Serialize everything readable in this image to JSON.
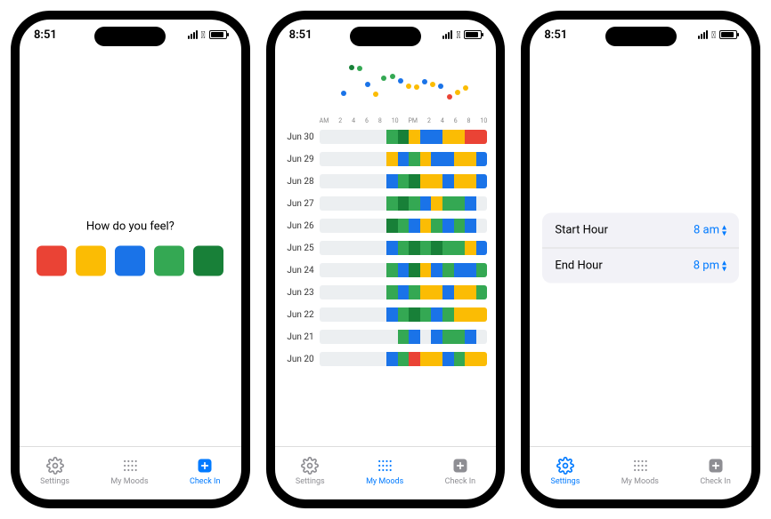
{
  "status": {
    "time": "8:51"
  },
  "tabbar": {
    "settings": "Settings",
    "mymoods": "My Moods",
    "checkin": "Check In"
  },
  "checkin": {
    "prompt": "How do you feel?",
    "moods": [
      {
        "name": "red",
        "color": "#ea4335"
      },
      {
        "name": "orange",
        "color": "#fbbc04"
      },
      {
        "name": "blue",
        "color": "#1a73e8"
      },
      {
        "name": "green",
        "color": "#34a853"
      },
      {
        "name": "dgreen",
        "color": "#188038"
      }
    ]
  },
  "settings": {
    "rows": [
      {
        "label": "Start Hour",
        "value": "8 am"
      },
      {
        "label": "End Hour",
        "value": "8 pm"
      }
    ]
  },
  "moods": {
    "hour_labels": [
      "AM",
      "2",
      "4",
      "6",
      "8",
      "10",
      "PM",
      "2",
      "4",
      "6",
      "8",
      "10"
    ],
    "scatter": [
      {
        "x": 28,
        "y": 60,
        "c": "blue"
      },
      {
        "x": 32,
        "y": 18,
        "c": "dgreen"
      },
      {
        "x": 36,
        "y": 20,
        "c": "green"
      },
      {
        "x": 40,
        "y": 45,
        "c": "blue"
      },
      {
        "x": 44,
        "y": 62,
        "c": "orange"
      },
      {
        "x": 48,
        "y": 35,
        "c": "green"
      },
      {
        "x": 52,
        "y": 33,
        "c": "green"
      },
      {
        "x": 56,
        "y": 40,
        "c": "blue"
      },
      {
        "x": 60,
        "y": 48,
        "c": "orange"
      },
      {
        "x": 64,
        "y": 50,
        "c": "orange"
      },
      {
        "x": 68,
        "y": 42,
        "c": "blue"
      },
      {
        "x": 72,
        "y": 46,
        "c": "orange"
      },
      {
        "x": 76,
        "y": 48,
        "c": "blue"
      },
      {
        "x": 80,
        "y": 65,
        "c": "red"
      },
      {
        "x": 84,
        "y": 58,
        "c": "orange"
      },
      {
        "x": 88,
        "y": 52,
        "c": "orange"
      }
    ],
    "days": [
      {
        "label": "Jun 30",
        "segs": [
          "empty",
          "empty",
          "empty",
          "empty",
          "empty",
          "empty",
          "green",
          "dgreen",
          "orange",
          "blue",
          "blue",
          "orange",
          "orange",
          "red",
          "red"
        ]
      },
      {
        "label": "Jun 29",
        "segs": [
          "empty",
          "empty",
          "empty",
          "empty",
          "empty",
          "empty",
          "orange",
          "blue",
          "green",
          "orange",
          "blue",
          "blue",
          "orange",
          "orange",
          "blue"
        ]
      },
      {
        "label": "Jun 28",
        "segs": [
          "empty",
          "empty",
          "empty",
          "empty",
          "empty",
          "empty",
          "blue",
          "green",
          "dgreen",
          "orange",
          "orange",
          "blue",
          "orange",
          "orange",
          "blue"
        ]
      },
      {
        "label": "Jun 27",
        "segs": [
          "empty",
          "empty",
          "empty",
          "empty",
          "empty",
          "empty",
          "green",
          "dgreen",
          "green",
          "blue",
          "orange",
          "green",
          "green",
          "blue",
          "empty"
        ]
      },
      {
        "label": "Jun 26",
        "segs": [
          "empty",
          "empty",
          "empty",
          "empty",
          "empty",
          "empty",
          "dgreen",
          "green",
          "blue",
          "orange",
          "green",
          "blue",
          "green",
          "blue",
          "empty"
        ]
      },
      {
        "label": "Jun 25",
        "segs": [
          "empty",
          "empty",
          "empty",
          "empty",
          "empty",
          "empty",
          "blue",
          "green",
          "dgreen",
          "green",
          "dgreen",
          "green",
          "green",
          "orange",
          "blue"
        ]
      },
      {
        "label": "Jun 24",
        "segs": [
          "empty",
          "empty",
          "empty",
          "empty",
          "empty",
          "empty",
          "green",
          "blue",
          "dgreen",
          "orange",
          "blue",
          "green",
          "blue",
          "blue",
          "green"
        ]
      },
      {
        "label": "Jun 23",
        "segs": [
          "empty",
          "empty",
          "empty",
          "empty",
          "empty",
          "empty",
          "green",
          "blue",
          "green",
          "orange",
          "orange",
          "blue",
          "orange",
          "orange",
          "green"
        ]
      },
      {
        "label": "Jun 22",
        "segs": [
          "empty",
          "empty",
          "empty",
          "empty",
          "empty",
          "empty",
          "blue",
          "green",
          "dgreen",
          "green",
          "blue",
          "green",
          "orange",
          "orange",
          "orange"
        ]
      },
      {
        "label": "Jun 21",
        "segs": [
          "empty",
          "empty",
          "empty",
          "empty",
          "empty",
          "empty",
          "empty",
          "green",
          "blue",
          "empty",
          "blue",
          "green",
          "green",
          "blue",
          "empty"
        ]
      },
      {
        "label": "Jun 20",
        "segs": [
          "empty",
          "empty",
          "empty",
          "empty",
          "empty",
          "empty",
          "blue",
          "green",
          "red",
          "orange",
          "orange",
          "blue",
          "green",
          "orange",
          "orange"
        ]
      }
    ]
  }
}
